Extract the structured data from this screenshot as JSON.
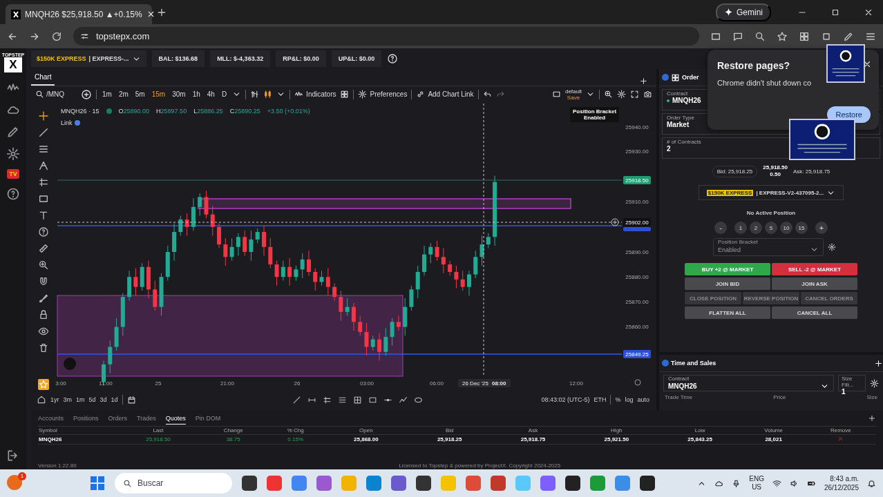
{
  "browser": {
    "tab_title": "MNQH26 $25,918.50 ▲+0.15%",
    "gemini": "Gemini",
    "url": "topstepx.com"
  },
  "popup": {
    "title": "Restore pages?",
    "message": "Chrome didn't shut down co",
    "button": "Restore"
  },
  "rail": {
    "logo": "TOPSTEP",
    "logo_mark": "X",
    "badge": "TV"
  },
  "header": {
    "account": {
      "tag": "$150K EXPRESS",
      "name": " | EXPRESS-..."
    },
    "stats": [
      "BAL: $136.68",
      "MLL: $-4,363.32",
      "RP&L: $0.00",
      "UP&L: $0.00"
    ]
  },
  "chart": {
    "tab": "Chart",
    "symbol": "/MNQ",
    "intervals": [
      {
        "label": "1m",
        "selected": false
      },
      {
        "label": "2m",
        "selected": false
      },
      {
        "label": "5m",
        "selected": false
      },
      {
        "label": "15m",
        "selected": true
      },
      {
        "label": "30m",
        "selected": false
      },
      {
        "label": "1h",
        "selected": false
      },
      {
        "label": "4h",
        "selected": false
      },
      {
        "label": "D",
        "selected": false
      }
    ],
    "indicators": "Indicators",
    "preferences": "Preferences",
    "add_link": "Add Chart Link",
    "layout": {
      "name": "default",
      "action": "Save"
    },
    "legend": {
      "title": "MNQH26 · 15",
      "ohlc": [
        {
          "key": "O",
          "value": "25890.00"
        },
        {
          "key": "H",
          "value": "25897.50"
        },
        {
          "key": "L",
          "value": "25886.25"
        },
        {
          "key": "C",
          "value": "25890.25"
        }
      ],
      "change": "+3.50 (+0.01%)",
      "link": "Link"
    },
    "tooltip": [
      "Position Bracket",
      "Enabled"
    ],
    "price_labels": [
      "25940.00",
      "25930.00",
      "25910.00",
      "25890.00",
      "25880.00",
      "25870.00",
      "25860.00"
    ],
    "price_markers": [
      {
        "label": "25918.50",
        "kind": "last"
      },
      {
        "label": "25902.00",
        "kind": "crosshair"
      },
      {
        "label": "25849.25",
        "kind": "line"
      }
    ],
    "time_labels": [
      "3:00",
      "11:00",
      "25",
      "21:00",
      "26",
      "03:00",
      "06:00",
      "12:00"
    ],
    "crosshair_time": {
      "date": "26 Dec '25",
      "time": "08:00"
    },
    "ranges": [
      "1yr",
      "3m",
      "1m",
      "5d",
      "3d",
      "1d"
    ],
    "clock": "08:43:02 (UTC-5)",
    "session": "ETH",
    "scale_options": [
      "%",
      "log",
      "auto"
    ]
  },
  "order": {
    "tab": "Order",
    "contract": {
      "label": "Contract",
      "value": "MNQH26"
    },
    "order_type": {
      "label": "Order Type",
      "value": "Market"
    },
    "contracts": {
      "label": "# of Contracts",
      "value": "2"
    },
    "bid": "Bid: 25,918.25",
    "last": "25,918.50",
    "spread": "0.50",
    "ask": "Ask: 25,918.75",
    "account": {
      "tag": "$150K EXPRESS",
      "name": " | EXPRESS-V2-437095-2..."
    },
    "position": "No Active Position",
    "quantity_buttons": [
      "-",
      "1",
      "2",
      "5",
      "10",
      "15",
      "+"
    ],
    "bracket": {
      "label": "Position Bracket",
      "value": "Enabled"
    },
    "actions": [
      {
        "label": "BUY +2 @ MARKET",
        "kind": "buy",
        "disabled": false
      },
      {
        "label": "SELL -2 @ MARKET",
        "kind": "sell",
        "disabled": false
      },
      {
        "label": "JOIN BID",
        "kind": "half",
        "disabled": false
      },
      {
        "label": "JOIN ASK",
        "kind": "half",
        "disabled": false
      },
      {
        "label": "CLOSE POSITION",
        "kind": "third",
        "disabled": true
      },
      {
        "label": "REVERSE POSITION",
        "kind": "third",
        "disabled": true
      },
      {
        "label": "CANCEL ORDERS",
        "kind": "third",
        "disabled": true
      },
      {
        "label": "FLATTEN ALL",
        "kind": "half",
        "disabled": false
      },
      {
        "label": "CANCEL ALL",
        "kind": "half",
        "disabled": false
      }
    ]
  },
  "time_and_sales": {
    "title": "Time and Sales",
    "contract": {
      "label": "Contract",
      "value": "MNQH26"
    },
    "size_filter": {
      "label": "Size Filt...",
      "value": "1"
    },
    "columns": [
      "Trade Time",
      "Price",
      "Size"
    ]
  },
  "bottom": {
    "tabs": [
      {
        "label": "Accounts",
        "selected": false
      },
      {
        "label": "Positions",
        "selected": false
      },
      {
        "label": "Orders",
        "selected": false
      },
      {
        "label": "Trades",
        "selected": false
      },
      {
        "label": "Quotes",
        "selected": true
      },
      {
        "label": "Pin DOM",
        "selected": false
      }
    ],
    "columns": [
      "Symbol",
      "Last",
      "Change",
      "% Chg",
      "Open",
      "Bid",
      "Ask",
      "High",
      "Low",
      "Volume",
      "Remove"
    ],
    "rows": [
      {
        "cells": [
          {
            "text": "MNQH26",
            "kind": "plain"
          },
          {
            "text": "25,918.50",
            "kind": "up"
          },
          {
            "text": "38.75",
            "kind": "up"
          },
          {
            "text": "0.15%",
            "kind": "up"
          },
          {
            "text": "25,868.00",
            "kind": "bold"
          },
          {
            "text": "25,918.25",
            "kind": "bold"
          },
          {
            "text": "25,918.75",
            "kind": "bold"
          },
          {
            "text": "25,921.50",
            "kind": "bold"
          },
          {
            "text": "25,843.25",
            "kind": "bold"
          },
          {
            "text": "28,021",
            "kind": "bold"
          }
        ]
      }
    ]
  },
  "footer": {
    "version": "Version 1.22.80",
    "license": "Licensed to Topstep & powered by ProjectX. Copyright 2024-2025"
  },
  "taskbar": {
    "notification_count": "1",
    "search": "Buscar",
    "language": [
      "ENG",
      "US"
    ],
    "time": "8:43 a.m.",
    "date": "26/12/2025"
  }
}
